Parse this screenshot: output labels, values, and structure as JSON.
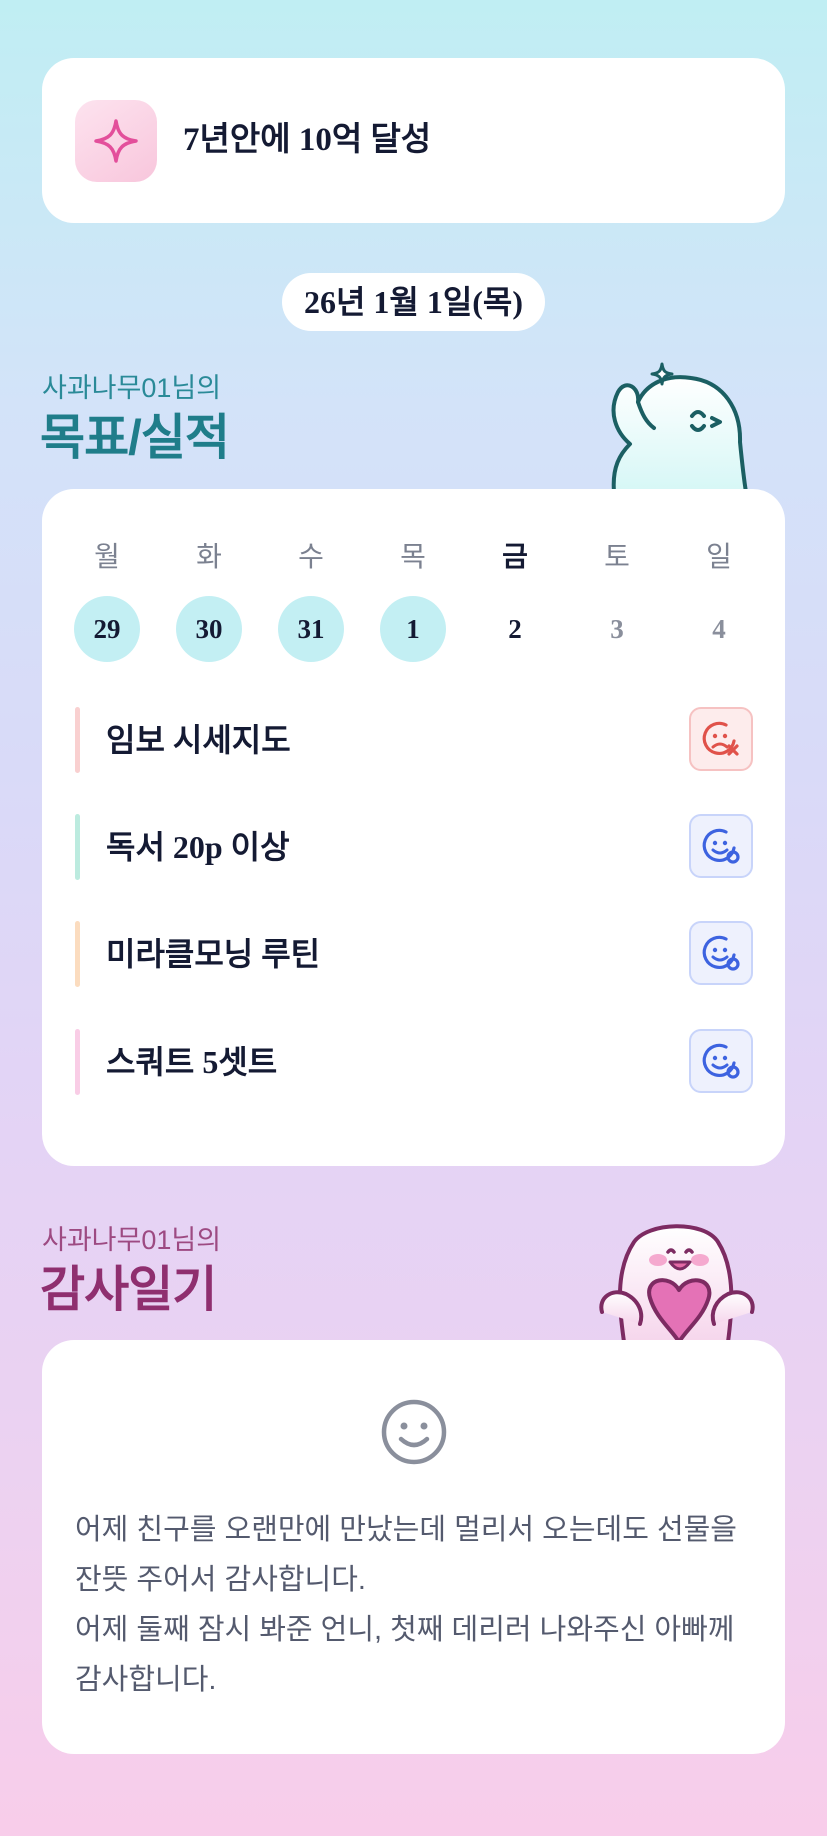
{
  "goal": {
    "title": "7년안에 10억 달성",
    "icon": "sparkle-icon"
  },
  "date": "26년 1월 1일(목)",
  "goals_section": {
    "subtitle": "사과나무01님의",
    "title": "목표/실적"
  },
  "week": {
    "weekdays": [
      "월",
      "화",
      "수",
      "목",
      "금",
      "토",
      "일"
    ],
    "days": [
      "29",
      "30",
      "31",
      "1",
      "2",
      "3",
      "4"
    ],
    "today_index": 4
  },
  "tasks": [
    {
      "label": "임보 시세지도",
      "status": "failed",
      "status_icon": "sad-face-x-icon",
      "bar_color": "#f9d0d0"
    },
    {
      "label": "독서 20p 이상",
      "status": "done",
      "status_icon": "smile-face-check-icon",
      "bar_color": "#bcebdf"
    },
    {
      "label": "미라클모닝 루틴",
      "status": "done",
      "status_icon": "smile-face-check-icon",
      "bar_color": "#fbdcbf"
    },
    {
      "label": "스쿼트 5셋트",
      "status": "done",
      "status_icon": "smile-face-check-icon",
      "bar_color": "#f9cde6"
    }
  ],
  "gratitude_section": {
    "subtitle": "사과나무01님의",
    "title": "감사일기"
  },
  "gratitude": {
    "icon": "smile-icon",
    "lines": [
      "어제 친구를 오랜만에 만났는데 멀리서 오는데도 선물을 잔뜻 주어서 감사합니다.",
      "어제 둘째 잠시 봐준 언니, 첫째 데리러 나와주신 아빠께 감사합니다."
    ]
  },
  "colors": {
    "accent_teal": "#1f7d8a",
    "accent_plum": "#8f2f6f",
    "done_day_bg": "#c3eff3",
    "fail_red": "#e0524a",
    "ok_blue": "#3d63e0"
  }
}
